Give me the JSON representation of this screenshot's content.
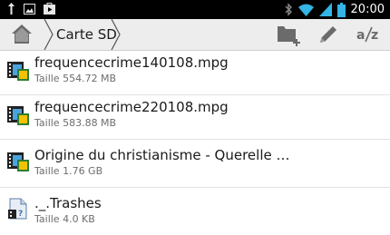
{
  "statusbar": {
    "clock": "20:00",
    "left_icons": [
      "usb-icon",
      "image-icon",
      "play-store-icon"
    ],
    "right_icons": [
      "bluetooth-icon",
      "wifi-icon",
      "signal-icon",
      "battery-icon"
    ]
  },
  "actionbar": {
    "breadcrumb": "Carte SD",
    "tools": [
      "new-folder-icon",
      "edit-icon",
      "sort-az-icon"
    ]
  },
  "files": [
    {
      "name": "frequencecrime140108.mpg",
      "size": "Taille 554.72 MB",
      "icon": "video-file-icon"
    },
    {
      "name": "frequencecrime220108.mpg",
      "size": "Taille 583.88 MB",
      "icon": "video-file-icon"
    },
    {
      "name": "Origine du christianisme - Querelle …",
      "size": "Taille 1.76 GB",
      "icon": "video-file-icon"
    },
    {
      "name": "._.Trashes",
      "size": "Taille 4.0 KB",
      "icon": "unknown-file-icon"
    }
  ]
}
